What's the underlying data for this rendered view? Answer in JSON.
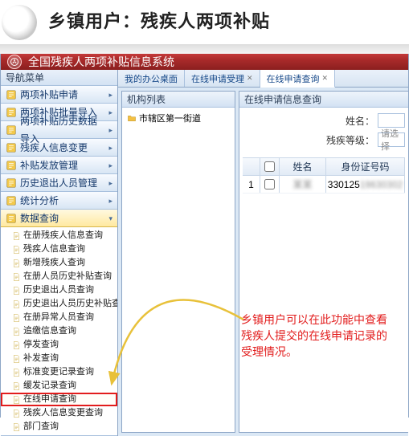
{
  "page_title": "乡镇用户：残疾人两项补贴",
  "app_title": "全国残疾人两项补贴信息系统",
  "sidebar": {
    "header": "导航菜单",
    "groups": [
      {
        "label": "两项补贴申请"
      },
      {
        "label": "两项补贴批量导入"
      },
      {
        "label": "两项补贴历史数据导入"
      },
      {
        "label": "残疾人信息变更"
      },
      {
        "label": "补贴发放管理"
      },
      {
        "label": "历史退出人员管理"
      },
      {
        "label": "统计分析"
      },
      {
        "label": "数据查询",
        "active": true
      }
    ],
    "tree": [
      {
        "label": "在册残疾人信息查询"
      },
      {
        "label": "残疾人信息查询"
      },
      {
        "label": "新增残疾人查询"
      },
      {
        "label": "在册人员历史补贴查询"
      },
      {
        "label": "历史退出人员查询"
      },
      {
        "label": "历史退出人员历史补贴查询"
      },
      {
        "label": "在册异常人员查询"
      },
      {
        "label": "追缴信息查询"
      },
      {
        "label": "停发查询"
      },
      {
        "label": "补发查询"
      },
      {
        "label": "标准变更记录查询"
      },
      {
        "label": "缓发记录查询"
      },
      {
        "label": "在线申请查询",
        "highlight": true
      },
      {
        "label": "残疾人信息变更查询"
      },
      {
        "label": "部门查询"
      }
    ]
  },
  "tabs": [
    {
      "label": "我的办公桌面"
    },
    {
      "label": "在线申请受理",
      "closable": true
    },
    {
      "label": "在线申请查询",
      "closable": true,
      "active": true
    }
  ],
  "org_panel": {
    "title": "机构列表",
    "root": "市辖区第一街道"
  },
  "query_panel": {
    "title": "在线申请信息查询",
    "form": {
      "name_label": "姓名：",
      "name_value": "",
      "level_label": "残疾等级：",
      "level_placeholder": "请选择"
    },
    "columns": {
      "idx": "",
      "chk": "",
      "name": "姓名",
      "idno": "身份证号码"
    },
    "rows": [
      {
        "idx": "1",
        "name": "",
        "idno_prefix": "330125",
        "idno_rest": "19630302"
      }
    ]
  },
  "annotation": "乡镇用户可以在此功能中查看残疾人提交的在线申请记录的受理情况。"
}
